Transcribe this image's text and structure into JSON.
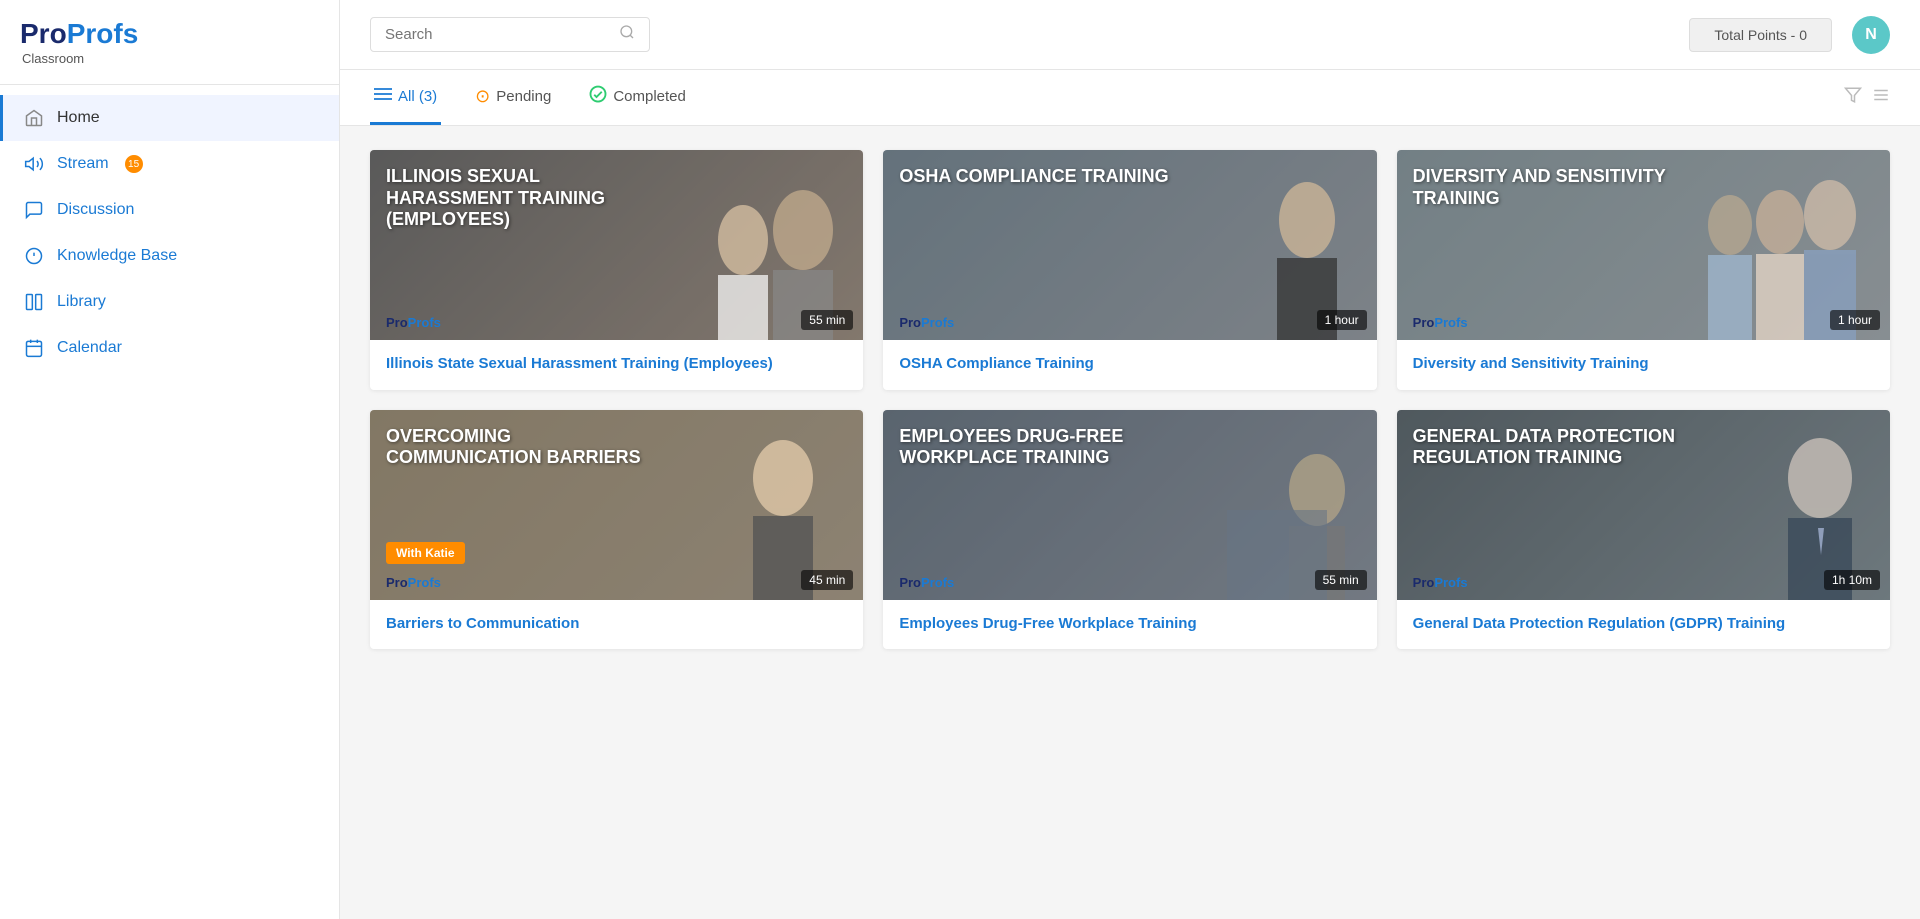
{
  "logo": {
    "pro": "Pro",
    "profs": "Profs",
    "classroom": "Classroom"
  },
  "nav": {
    "items": [
      {
        "id": "home",
        "label": "Home",
        "icon": "home-icon",
        "active": true,
        "badge": null
      },
      {
        "id": "stream",
        "label": "Stream",
        "icon": "stream-icon",
        "active": false,
        "badge": "15"
      },
      {
        "id": "discussion",
        "label": "Discussion",
        "icon": "discussion-icon",
        "active": false,
        "badge": null
      },
      {
        "id": "knowledge-base",
        "label": "Knowledge Base",
        "icon": "knowledge-icon",
        "active": false,
        "badge": null
      },
      {
        "id": "library",
        "label": "Library",
        "icon": "library-icon",
        "active": false,
        "badge": null
      },
      {
        "id": "calendar",
        "label": "Calendar",
        "icon": "calendar-icon",
        "active": false,
        "badge": null
      }
    ]
  },
  "topbar": {
    "search_placeholder": "Search",
    "total_points_label": "Total Points - 0",
    "user_initial": "N"
  },
  "filter_tabs": [
    {
      "id": "all",
      "label": "All (3)",
      "active": true,
      "icon": "≡"
    },
    {
      "id": "pending",
      "label": "Pending",
      "active": false,
      "icon": "⊙"
    },
    {
      "id": "completed",
      "label": "Completed",
      "active": false,
      "icon": "✓"
    }
  ],
  "courses": [
    {
      "id": 1,
      "thumbnail_title": "ILLINOIS SEXUAL HARASSMENT TRAINING (EMPLOYEES)",
      "duration": "55 min",
      "title": "Illinois State Sexual Harassment Training (Employees)",
      "thumb_class": "thumb-1",
      "with_katie": false
    },
    {
      "id": 2,
      "thumbnail_title": "OSHA COMPLIANCE TRAINING",
      "duration": "1 hour",
      "title": "OSHA Compliance Training",
      "thumb_class": "thumb-2",
      "with_katie": false
    },
    {
      "id": 3,
      "thumbnail_title": "DIVERSITY AND SENSITIVITY TRAINING",
      "duration": "1 hour",
      "title": "Diversity and Sensitivity Training",
      "thumb_class": "thumb-3",
      "with_katie": false
    },
    {
      "id": 4,
      "thumbnail_title": "OVERCOMING COMMUNICATION BARRIERS",
      "duration": "45 min",
      "title": "Barriers to Communication",
      "thumb_class": "thumb-4",
      "with_katie": true,
      "with_katie_label": "With Katie"
    },
    {
      "id": 5,
      "thumbnail_title": "EMPLOYEES DRUG-FREE WORKPLACE TRAINING",
      "duration": "55 min",
      "title": "Employees Drug-Free Workplace Training",
      "thumb_class": "thumb-5",
      "with_katie": false
    },
    {
      "id": 6,
      "thumbnail_title": "GENERAL DATA PROTECTION REGULATION TRAINING",
      "duration": "1h 10m",
      "title": "General Data Protection Regulation (GDPR) Training",
      "thumb_class": "thumb-6",
      "with_katie": false
    }
  ],
  "logo_label": {
    "pro": "Pro",
    "profs": "Profs"
  }
}
